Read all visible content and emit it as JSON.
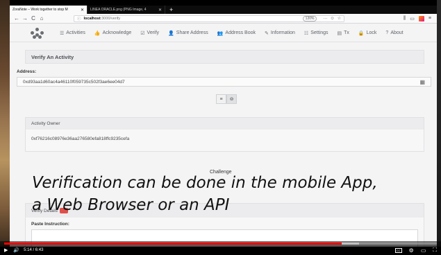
{
  "browser": {
    "tabs": [
      {
        "label": "ZoraNote – Work together to stop M",
        "active": true
      },
      {
        "label": "LINEA ORACLE.png (PNG Image, 4",
        "active": false
      }
    ],
    "new_tab": "+",
    "tab_close": "✕",
    "nav": {
      "back": "←",
      "forward": "→",
      "reload": "C",
      "home": "⌂"
    },
    "url": {
      "host": "localhost",
      "path": ":3000/verify",
      "info": "ⓘ"
    },
    "zoom": "120%",
    "url_buttons": [
      "···",
      "☺",
      "☆"
    ],
    "toolbar_right": [
      "⫼",
      "▭",
      "≡"
    ]
  },
  "app_nav": {
    "items": [
      {
        "icon": "☰",
        "label": "Activities"
      },
      {
        "icon": "👍",
        "label": "Acknowledge"
      },
      {
        "icon": "☑",
        "label": "Verify"
      },
      {
        "icon": "👤",
        "label": "Share Address"
      },
      {
        "icon": "👥",
        "label": "Address Book"
      },
      {
        "icon": "✎",
        "label": "Information"
      },
      {
        "icon": "☷",
        "label": "Settings"
      },
      {
        "icon": "▤",
        "label": "Tx"
      },
      {
        "icon": "🔒",
        "label": "Lock"
      },
      {
        "icon": "?",
        "label": "About"
      }
    ]
  },
  "page": {
    "title": "Verify An Activity",
    "address_label": "Address:",
    "address_value": "0xd93aa1d60ac4a46110f059735c502f3ae6ee04d7",
    "group_buttons": [
      "≡",
      "⊚"
    ],
    "owner_label": "Activity Owner",
    "owner_value": "0xf76216c08976e36aa276580efa818ffc9235cefa",
    "challenge_label": "Challenge",
    "verify_label": "Verify Details",
    "paste_label": "Paste Instruction:"
  },
  "caption": {
    "line1": "Verification can be done in the mobile App,",
    "line2": "a Web Browser or an API"
  },
  "player": {
    "time": "5:14 / 6:43",
    "played_fraction": 0.78,
    "loaded_fraction": 0.82,
    "play_icon": "▶",
    "volume_icon": "🔊",
    "right_icons": [
      "⚙",
      "▭",
      "⛶"
    ],
    "cc": "CC"
  }
}
